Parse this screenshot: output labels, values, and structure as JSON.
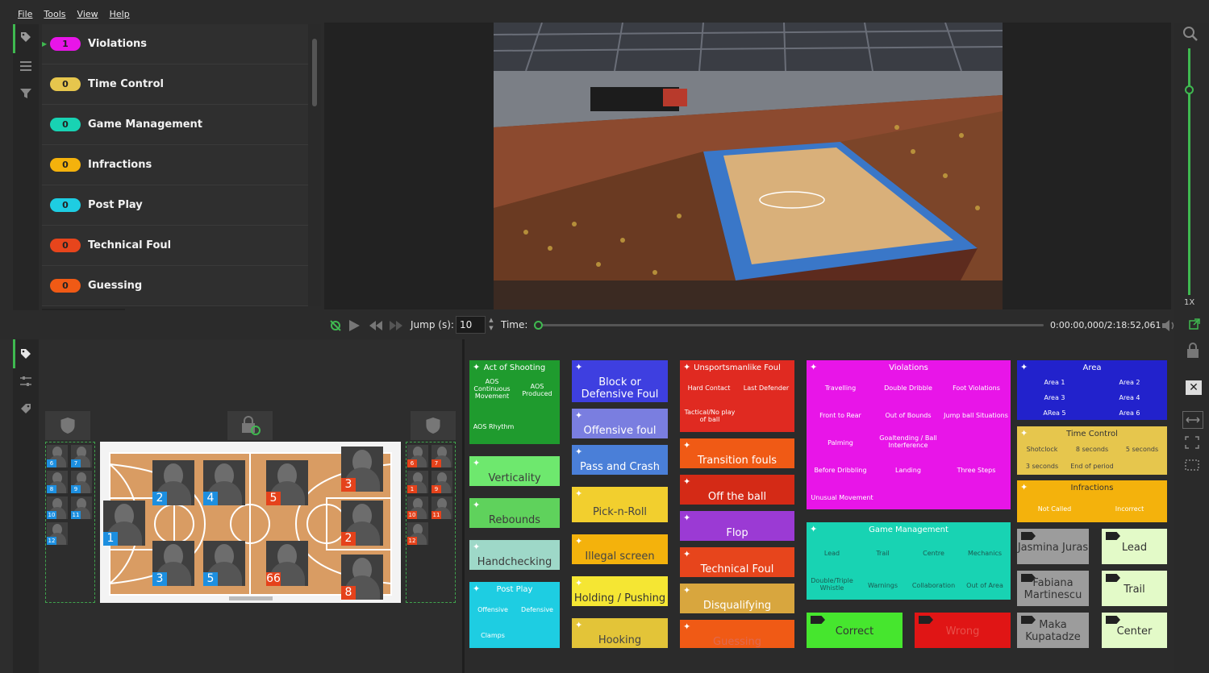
{
  "menu": [
    "File",
    "Tools",
    "View",
    "Help"
  ],
  "categories": [
    {
      "count": "1",
      "label": "Violations",
      "color": "#e815e8"
    },
    {
      "count": "0",
      "label": "Time Control",
      "color": "#e6c64d"
    },
    {
      "count": "0",
      "label": "Game Management",
      "color": "#18d3b3"
    },
    {
      "count": "0",
      "label": "Infractions",
      "color": "#f4b20c"
    },
    {
      "count": "0",
      "label": "Post Play",
      "color": "#1ecde2"
    },
    {
      "count": "0",
      "label": "Technical Foul",
      "color": "#e7451c"
    },
    {
      "count": "0",
      "label": "Guessing",
      "color": "#f05a15"
    }
  ],
  "controls": {
    "jump_label": "Jump (s):",
    "jump_value": "10",
    "time_label": "Time:",
    "time_readout": "0:00:00,000/2:18:52,061",
    "zoom": "1X"
  },
  "court": {
    "left_bench": [
      "6",
      "7",
      "8",
      "9",
      "10",
      "11",
      "12"
    ],
    "right_bench": [
      "6",
      "7",
      "1",
      "9",
      "10",
      "11",
      "12"
    ],
    "blue_players": [
      "1",
      "2",
      "4",
      "3",
      "5"
    ],
    "red_players": [
      "5",
      "3",
      "2",
      "66",
      "8"
    ]
  },
  "buttons": {
    "act_of_shooting": {
      "title": "Act of Shooting",
      "subs": [
        "AOS Continuous Movement",
        "AOS Produced",
        "AOS Rhythm"
      ]
    },
    "verticality": "Verticality",
    "rebounds": "Rebounds",
    "handchecking": "Handchecking",
    "post_play": {
      "title": "Post Play",
      "subs": [
        "Offensive",
        "Defensive",
        "Clamps"
      ]
    },
    "block": "Block or Defensive Foul",
    "offensive_foul": "Offensive foul",
    "pass_and_crash": "Pass and Crash",
    "pick_n_roll": "Pick-n-Roll",
    "illegal_screen": "Illegal screen",
    "holding": "Holding / Pushing",
    "hooking": "Hooking",
    "unsportsmanlike": {
      "title": "Unsportsmanlike Foul",
      "subs": [
        "Hard Contact",
        "Last Defender",
        "Tactical/No play of ball"
      ]
    },
    "transition": "Transition fouls",
    "off_the_ball": "Off the ball",
    "flop": "Flop",
    "technical_foul": "Technical Foul",
    "disqualifying": "Disqualifying",
    "guessing": "Guessing",
    "violations": {
      "title": "Violations",
      "subs": [
        "Travelling",
        "Double Dribble",
        "Foot Violations",
        "Front to Rear",
        "Out of Bounds",
        "Jump ball Situations",
        "Palming",
        "Goaltending / Ball Interference",
        "Before Dribbling",
        "Landing",
        "Three Steps",
        "Unusual Movement"
      ]
    },
    "game_management": {
      "title": "Game Management",
      "subs": [
        "Lead",
        "Trail",
        "Centre",
        "Mechanics",
        "Double/Triple Whistle",
        "Warnings",
        "Collaboration",
        "Out of Area"
      ]
    },
    "correct": "Correct",
    "wrong": "Wrong",
    "area": {
      "title": "Area",
      "subs": [
        "Area 1",
        "Area 2",
        "Area 3",
        "Area 4",
        "ARea 5",
        "Area 6"
      ]
    },
    "time_control": {
      "title": "Time Control",
      "subs": [
        "Shotclock",
        "8 seconds",
        "5 seconds",
        "3 seconds",
        "End of period"
      ]
    },
    "infractions": {
      "title": "Infractions",
      "subs": [
        "Not Called",
        "Incorrect"
      ]
    },
    "ref1": "Jasmina Juras",
    "ref2": "Fabiana Martinescu",
    "ref3": "Maka Kupatadze",
    "lead": "Lead",
    "trail": "Trail",
    "center": "Center"
  }
}
